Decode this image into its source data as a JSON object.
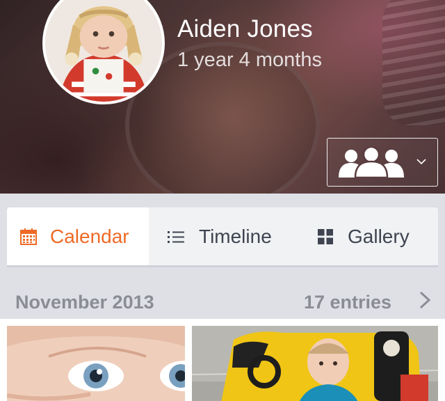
{
  "profile": {
    "name": "Aiden Jones",
    "age": "1 year 4 months"
  },
  "share_button": {
    "icon": "people-group-icon",
    "dropdown_icon": "chevron-down-icon"
  },
  "tabs": [
    {
      "label": "Calendar",
      "icon": "calendar-icon",
      "active": true
    },
    {
      "label": "Timeline",
      "icon": "list-icon",
      "active": false
    },
    {
      "label": "Gallery",
      "icon": "grid-icon",
      "active": false
    }
  ],
  "month_section": {
    "title": "November 2013",
    "entries": "17 entries"
  },
  "colors": {
    "accent": "#ee6a26",
    "tab_text": "#3e4450",
    "section_text": "#8b8d95",
    "background": "#dfe0e6"
  }
}
